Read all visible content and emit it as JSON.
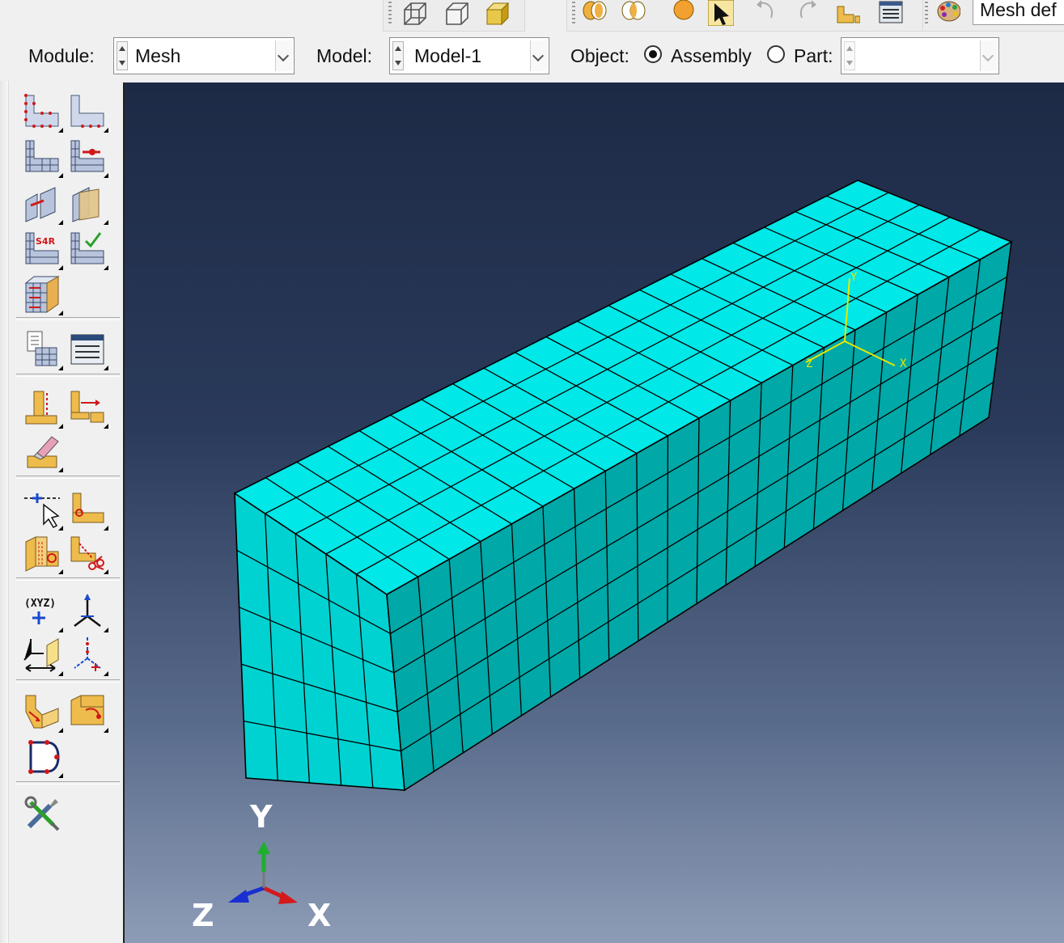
{
  "toolbar": {
    "render_icons": [
      "wireframe-icon",
      "hidden-lines-icon",
      "shaded-icon"
    ],
    "view_icons": [
      "boolean-union-icon",
      "boolean-intersect-icon",
      "sphere-icon",
      "select-arrow-icon",
      "undo-view-icon",
      "redo-view-icon",
      "part-display-icon",
      "query-icon",
      "color-palette-icon"
    ],
    "mesh_defaults_label": "Mesh def"
  },
  "context": {
    "module_label": "Module:",
    "module_value": "Mesh",
    "model_label": "Model:",
    "model_value": "Model-1",
    "object_label": "Object:",
    "assembly_label": "Assembly",
    "part_label": "Part:",
    "part_value": "",
    "selected_object": "Assembly"
  },
  "toolbox": {
    "icons": [
      "seed-part-instance-icon",
      "seed-edges-icon",
      "assign-mesh-controls-icon",
      "mesh-region-icon",
      "assign-stack-direction-icon",
      "partition-cell-icon",
      "assign-element-type-icon",
      "verify-mesh-icon",
      "mesh-part-instance-icon",
      "query-mesh-icon",
      "mesh-stats-icon",
      "edit-mesh-icon",
      "offset-mesh-icon",
      "delete-mesh-icon",
      "datum-point-icon",
      "create-set-icon",
      "partition-face-icon",
      "partition-cut-icon",
      "datum-xyz-icon",
      "datum-csys-icon",
      "datum-plane-icon",
      "datum-axis-icon",
      "repair-face-icon",
      "repair-edge-icon",
      "virtual-topology-icon",
      "tools-settings-icon"
    ]
  },
  "viewport": {
    "background_top": "#1d2a46",
    "background_bottom": "#8d9cb6",
    "mesh_color_top": "#00e8e8",
    "mesh_color_front": "#00d2d2",
    "mesh_color_side": "#00a8a8",
    "local_csys_labels": [
      "Y",
      "Z",
      "X"
    ],
    "triad_labels": {
      "y": "Y",
      "z": "Z",
      "x": "X"
    },
    "triad_colors": {
      "y": "#1fae2e",
      "z": "#1a2fd0",
      "x": "#d41a1a"
    }
  }
}
